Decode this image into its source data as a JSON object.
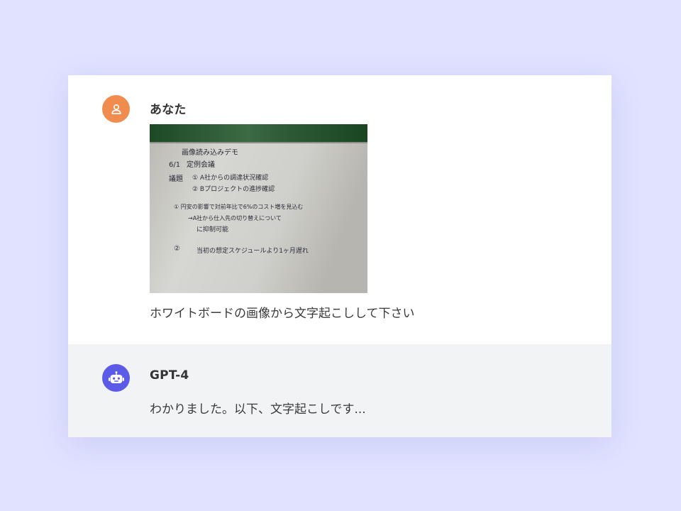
{
  "conversation": {
    "messages": [
      {
        "role": "user",
        "sender": "あなた",
        "avatar_icon": "person-icon",
        "avatar_color": "#ef8c4e",
        "attachment": {
          "type": "whiteboard-photo",
          "handwriting": [
            "画像読み込みデモ",
            "6/1",
            "定例会議",
            "議題",
            "① A社からの調達状況確認",
            "② Bプロジェクトの進捗確認",
            "① 円安の影響で対前年比で6%のコスト増を見込む",
            "→A社から仕入先の切り替えについて",
            "に抑制可能",
            "②",
            "当初の想定スケジュールより1ヶ月遅れ"
          ]
        },
        "text": "ホワイトボードの画像から文字起こしして下さい"
      },
      {
        "role": "assistant",
        "sender": "GPT-4",
        "avatar_icon": "robot-icon",
        "avatar_color": "#5b5be8",
        "text": "わかりました。以下、文字起こしです..."
      }
    ]
  },
  "colors": {
    "page_background": "#e0e2ff",
    "assistant_row_background": "#f2f3f5",
    "whiteboard_frame": "#1d4a24"
  }
}
